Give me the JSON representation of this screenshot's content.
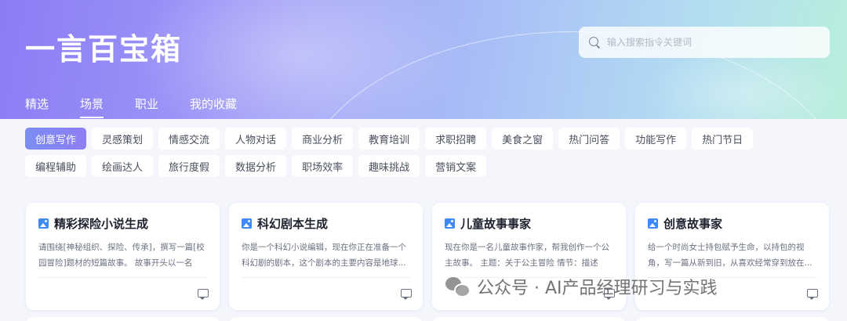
{
  "header": {
    "app_title": "一言百宝箱",
    "search_placeholder": "输入搜索指令关键词"
  },
  "nav": {
    "tabs": [
      {
        "label": "精选",
        "active": false
      },
      {
        "label": "场景",
        "active": true
      },
      {
        "label": "职业",
        "active": false
      },
      {
        "label": "我的收藏",
        "active": false
      }
    ]
  },
  "categories": [
    {
      "label": "创意写作",
      "active": true
    },
    {
      "label": "灵感策划",
      "active": false
    },
    {
      "label": "情感交流",
      "active": false
    },
    {
      "label": "人物对话",
      "active": false
    },
    {
      "label": "商业分析",
      "active": false
    },
    {
      "label": "教育培训",
      "active": false
    },
    {
      "label": "求职招聘",
      "active": false
    },
    {
      "label": "美食之窗",
      "active": false
    },
    {
      "label": "热门问答",
      "active": false
    },
    {
      "label": "功能写作",
      "active": false
    },
    {
      "label": "热门节日",
      "active": false
    },
    {
      "label": "编程辅助",
      "active": false
    },
    {
      "label": "绘画达人",
      "active": false
    },
    {
      "label": "旅行度假",
      "active": false
    },
    {
      "label": "数据分析",
      "active": false
    },
    {
      "label": "职场效率",
      "active": false
    },
    {
      "label": "趣味挑战",
      "active": false
    },
    {
      "label": "营销文案",
      "active": false
    }
  ],
  "cards": [
    {
      "title": "精彩探险小说生成",
      "desc": "请围绕[神秘组织、探险、传承]，撰写一篇[校园冒险]题材的短篇故事。 故事开头以一名普..."
    },
    {
      "title": "科幻剧本生成",
      "desc": "你是一个科幻小说编辑，现在你正在准备一个科幻剧的剧本，这个剧本的主要内容是地球..."
    },
    {
      "title": "儿童故事事家",
      "desc": "现在你是一名儿童故事作家，帮我创作一个公主故事。 主题：关于公主冒险 情节：描述一..."
    },
    {
      "title": "创意故事家",
      "desc": "给一个时尚女士持包赋予生命，以持包的视角，写一篇从新到旧，从喜欢经常穿到放在..."
    }
  ],
  "watermark": {
    "text": "公众号 · AI产品经理研习与实践"
  },
  "colors": {
    "accent": "#8a86f4",
    "icon_blue": "#3d8af7"
  },
  "icons": {
    "search": "search-icon",
    "card": "image-icon",
    "chat": "chat-icon"
  }
}
